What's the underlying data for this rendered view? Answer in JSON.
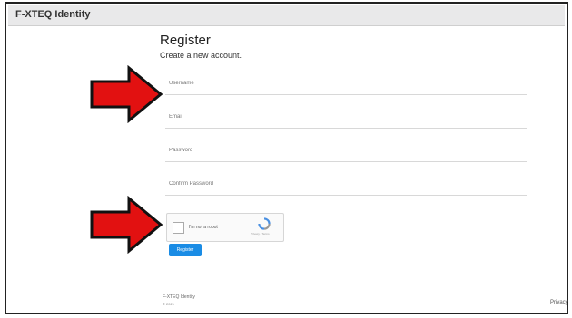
{
  "app": {
    "title": "F-XTEQ Identity"
  },
  "form": {
    "title": "Register",
    "subtitle": "Create a new account.",
    "fields": [
      {
        "name": "username",
        "placeholder": "Username"
      },
      {
        "name": "email",
        "placeholder": "Email"
      },
      {
        "name": "password",
        "placeholder": "Password"
      },
      {
        "name": "confirm",
        "placeholder": "Confirm Password"
      }
    ],
    "captcha": {
      "label": "I'm not a robot",
      "fineprint": "Privacy - Terms"
    },
    "submit_label": "Register"
  },
  "footer": {
    "copyright": "F-XTEQ Identity",
    "year": "© 2021",
    "privacy": "Privacy"
  },
  "colors": {
    "arrow": "#e21111",
    "button": "#1a8ce5"
  }
}
